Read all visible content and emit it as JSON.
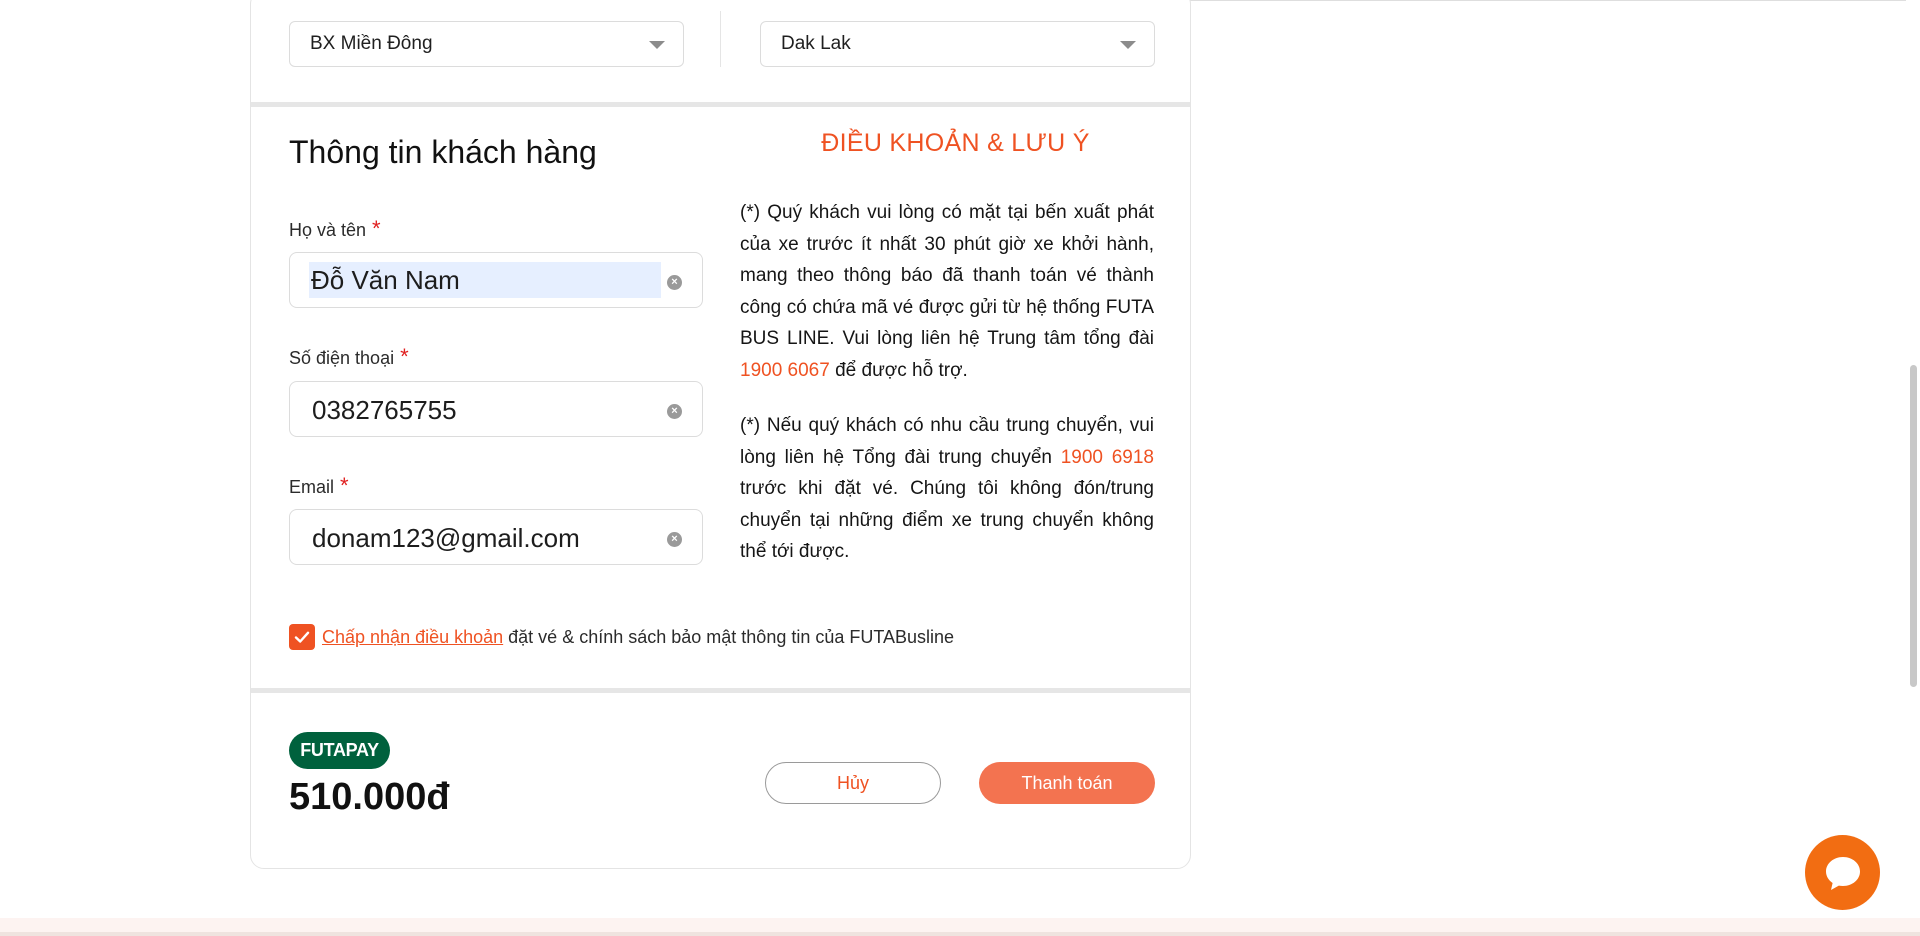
{
  "route": {
    "departure": "BX Miền Đông",
    "destination": "Dak Lak"
  },
  "customer": {
    "section_title": "Thông tin khách hàng",
    "fields": [
      {
        "label": "Họ và tên",
        "required_mark": "*",
        "value": "Đỗ Văn Nam"
      },
      {
        "label": "Số điện thoại",
        "required_mark": "*",
        "value": "0382765755"
      },
      {
        "label": "Email",
        "required_mark": "*",
        "value": "donam123@gmail.com"
      }
    ]
  },
  "terms": {
    "title": "ĐIỀU KHOẢN & LƯU Ý",
    "note1_before": "(*) Quý khách vui lòng có mặt tại bến xuất phát của xe trước ít nhất 30 phút giờ xe khởi hành, mang theo thông báo đã thanh toán vé thành công có chứa mã vé được gửi từ hệ thống FUTA BUS LINE. Vui lòng liên hệ Trung tâm tổng đài ",
    "note1_phone": "1900 6067",
    "note1_after": " để được hỗ trợ.",
    "note2_before": "(*) Nếu quý khách có nhu cầu trung chuyển, vui lòng liên hệ Tổng đài trung chuyển ",
    "note2_phone": "1900 6918",
    "note2_after": " trước khi đặt vé. Chúng tôi không đón/trung chuyển tại những điểm xe trung chuyển không thể tới được."
  },
  "agreement": {
    "checked": true,
    "link_text": "Chấp nhận điều khoản",
    "rest_text": "đặt vé & chính sách bảo mật thông tin của FUTABusline"
  },
  "payment": {
    "badge": "FUTAPAY",
    "total": "510.000đ",
    "cancel_label": "Hủy",
    "pay_label": "Thanh toán"
  },
  "colors": {
    "accent": "#ef5222",
    "futapay_green": "#00613d",
    "pay_button": "#f37350",
    "chat_button": "#f26d12"
  },
  "icons": {
    "select_caret": "chevron-down-icon",
    "clear": "clear-icon",
    "checkbox": "check-icon",
    "chat": "chat-bubble-icon"
  }
}
